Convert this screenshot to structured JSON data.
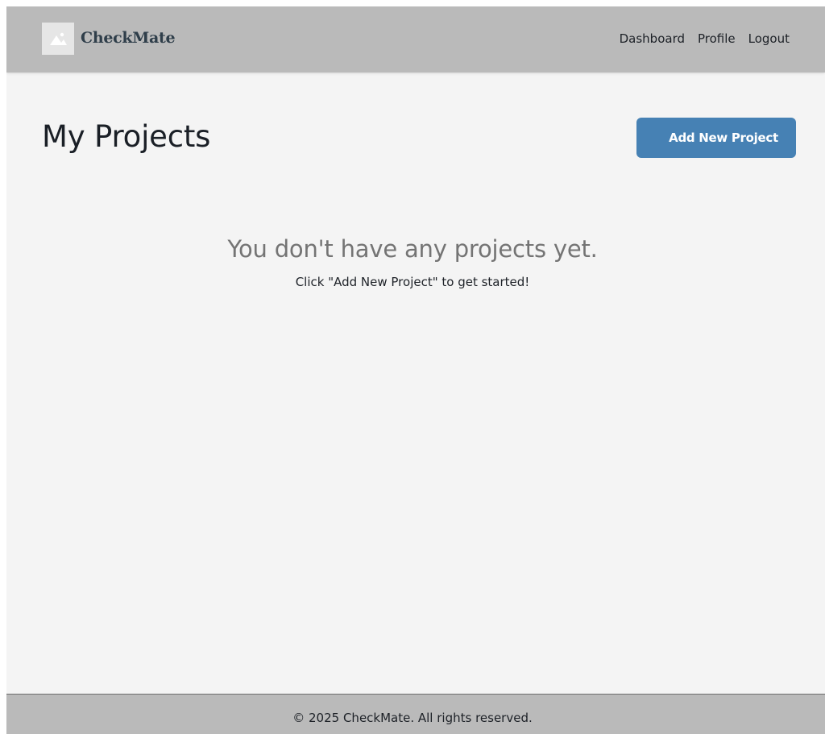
{
  "header": {
    "brand": "CheckMate",
    "logo_icon": "image-placeholder-icon",
    "nav": {
      "dashboard": "Dashboard",
      "profile": "Profile",
      "logout": "Logout"
    }
  },
  "main": {
    "title": "My Projects",
    "add_button_label": "Add New Project",
    "empty_state": {
      "heading": "You don't have any projects yet.",
      "subtext": "Click \"Add New Project\" to get started!"
    }
  },
  "footer": {
    "copyright": "© 2025 CheckMate. All rights reserved."
  },
  "colors": {
    "accent": "#4681b4",
    "header_bg": "#bababa",
    "page_bg": "#f4f4f4"
  }
}
